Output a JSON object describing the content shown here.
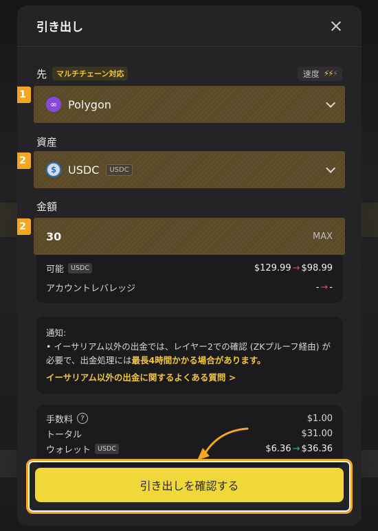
{
  "modal": {
    "title": "引き出し"
  },
  "destination": {
    "label": "先",
    "badge": "マルチチェーン対応",
    "speed_label": "速度",
    "step": "1",
    "selected": "Polygon"
  },
  "asset": {
    "label": "資産",
    "step": "2",
    "selected": "USDC",
    "badge": "USDC"
  },
  "amount": {
    "label": "金額",
    "step": "2",
    "value": "30",
    "max_label": "MAX"
  },
  "balance": {
    "available_label": "可能",
    "available_badge": "USDC",
    "available_from": "$129.99",
    "available_to": "$98.99",
    "leverage_label": "アカウントレバレッジ",
    "leverage_from": "-",
    "leverage_to": "-"
  },
  "notice": {
    "title": "通知:",
    "line1": "• イーサリアム以外の出金では、レイヤー2での確認 (ZKプルーフ経由) が必要で、出金処理には",
    "highlight": "最長4時間かかる場合があります。",
    "link": "イーサリアム以外の出金に関するよくある質問 >"
  },
  "summary": {
    "fee_label": "手数料",
    "fee_value": "$1.00",
    "total_label": "トータル",
    "total_value": "$31.00",
    "wallet_label": "ウォレット",
    "wallet_badge": "USDC",
    "wallet_from": "$6.36",
    "wallet_to": "$36.36"
  },
  "confirm_label": "引き出しを確認する",
  "colors": {
    "accent": "#f0d73a",
    "step_badge": "#f5a623",
    "highlight": "#f0c63c",
    "negative_arrow": "#e0457b",
    "positive_arrow": "#2ebd85"
  },
  "icons": {
    "close": "close-icon",
    "chain": "polygon-icon",
    "token": "usdc-icon",
    "speed": "lightning-icon",
    "help": "question-circle-icon"
  }
}
